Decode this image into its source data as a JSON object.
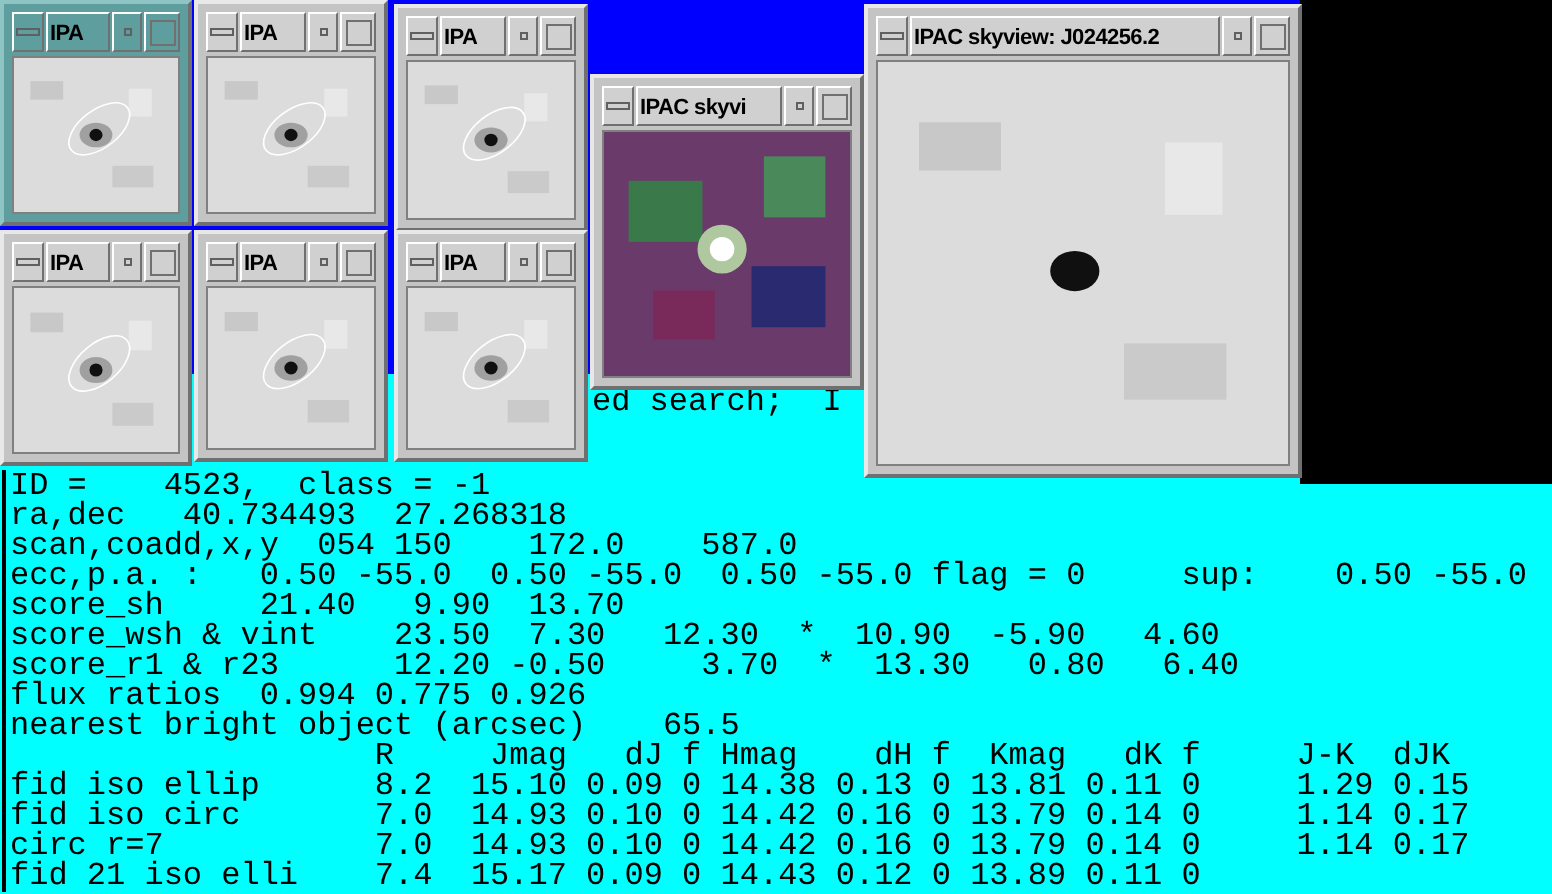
{
  "windows": [
    {
      "title": "IPA",
      "active": true,
      "kind": "grayscale",
      "ellipse": true
    },
    {
      "title": "IPA",
      "active": false,
      "kind": "grayscale",
      "ellipse": true
    },
    {
      "title": "IPA",
      "active": false,
      "kind": "grayscale",
      "ellipse": true
    },
    {
      "title": "IPA",
      "active": false,
      "kind": "grayscale",
      "ellipse": true
    },
    {
      "title": "IPA",
      "active": false,
      "kind": "grayscale",
      "ellipse": true
    },
    {
      "title": "IPA",
      "active": false,
      "kind": "grayscale",
      "ellipse": true
    },
    {
      "title": "IPAC skyvi",
      "active": false,
      "kind": "color",
      "ellipse": false
    },
    {
      "title": "IPAC skyview: J024256.2",
      "active": false,
      "kind": "grayscale",
      "ellipse": false
    }
  ],
  "terminal": {
    "partial_text": "ed search;  I",
    "lines": [
      "ID =    4523,  class = -1",
      "ra,dec   40.734493  27.268318",
      "scan,coadd,x,y  054 150    172.0    587.0",
      "ecc,p.a. :   0.50 -55.0  0.50 -55.0  0.50 -55.0 flag = 0     sup:    0.50 -55.0",
      "score_sh     21.40   9.90  13.70",
      "score_wsh & vint    23.50  7.30   12.30  *  10.90  -5.90   4.60",
      "score_r1 & r23      12.20 -0.50     3.70  *  13.30   0.80   6.40",
      "flux ratios  0.994 0.775 0.926",
      "nearest bright object (arcsec)    65.5",
      "                   R     Jmag   dJ f Hmag    dH f  Kmag   dK f     J-K  dJK",
      "fid iso ellip      8.2  15.10 0.09 0 14.38 0.13 0 13.81 0.11 0     1.29 0.15",
      "fid iso circ       7.0  14.93 0.10 0 14.42 0.16 0 13.79 0.14 0     1.14 0.17",
      "circ r=7           7.0  14.93 0.10 0 14.42 0.16 0 13.79 0.14 0     1.14 0.17",
      "fid 21 iso elli    7.4  15.17 0.09 0 14.43 0.12 0 13.89 0.11 0"
    ]
  }
}
